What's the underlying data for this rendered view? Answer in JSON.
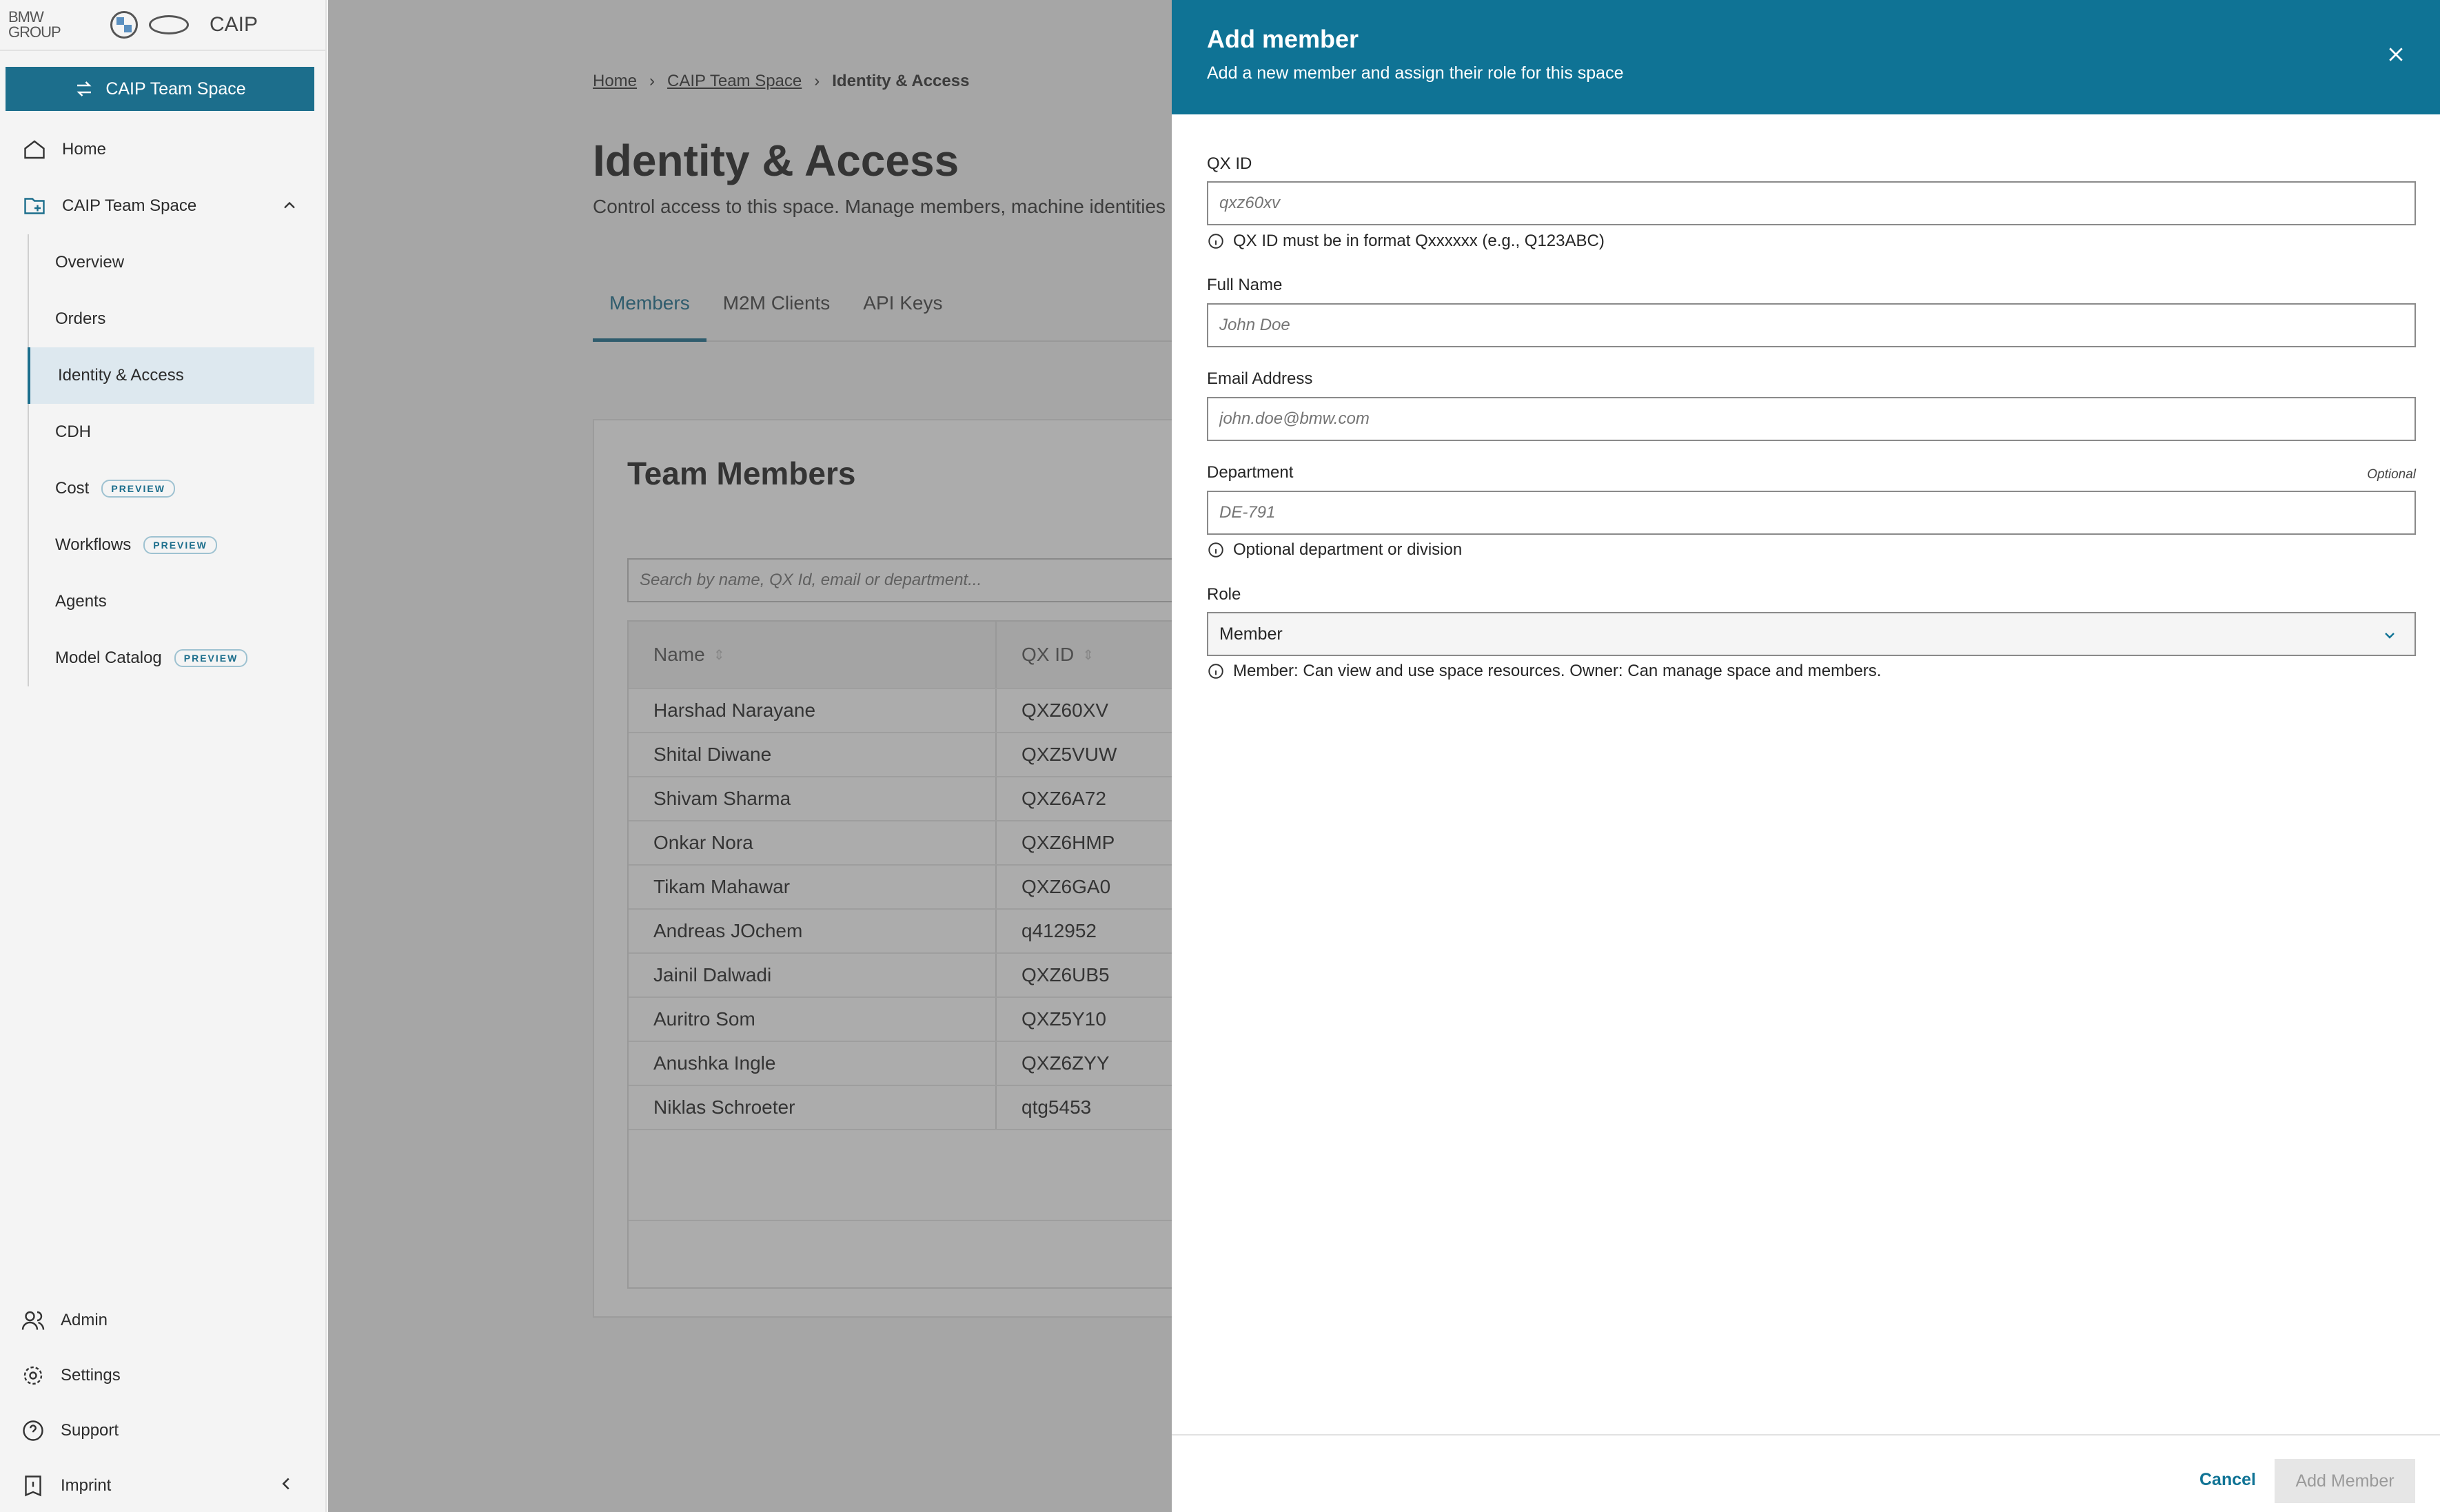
{
  "topbar": {
    "brand": "BMW GROUP",
    "app_name": "CAIP"
  },
  "sidebar": {
    "space_button": "CAIP Team Space",
    "home": "Home",
    "space": "CAIP Team Space",
    "sub_items": [
      {
        "label": "Overview"
      },
      {
        "label": "Orders"
      },
      {
        "label": "Identity & Access",
        "active": true
      },
      {
        "label": "CDH"
      },
      {
        "label": "Cost",
        "badge": "PREVIEW"
      },
      {
        "label": "Workflows",
        "badge": "PREVIEW"
      },
      {
        "label": "Agents"
      },
      {
        "label": "Model Catalog",
        "badge": "PREVIEW"
      }
    ],
    "bottom": {
      "admin": "Admin",
      "settings": "Settings",
      "support": "Support",
      "imprint": "Imprint"
    }
  },
  "breadcrumb": {
    "home": "Home",
    "space": "CAIP Team Space",
    "current": "Identity & Access"
  },
  "page": {
    "title": "Identity & Access",
    "description": "Control access to this space. Manage members, machine identities"
  },
  "tabs": [
    {
      "label": "Members",
      "active": true
    },
    {
      "label": "M2M Clients"
    },
    {
      "label": "API Keys"
    }
  ],
  "members": {
    "title": "Team Members",
    "search_placeholder": "Search by name, QX Id, email or department...",
    "columns": [
      "Name",
      "QX ID"
    ],
    "rows": [
      {
        "name": "Harshad Narayane",
        "qx": "QXZ60XV"
      },
      {
        "name": "Shital Diwane",
        "qx": "QXZ5VUW"
      },
      {
        "name": "Shivam Sharma",
        "qx": "QXZ6A72"
      },
      {
        "name": "Onkar Nora",
        "qx": "QXZ6HMP"
      },
      {
        "name": "Tikam Mahawar",
        "qx": "QXZ6GA0"
      },
      {
        "name": "Andreas JOchem",
        "qx": "q412952"
      },
      {
        "name": "Jainil Dalwadi",
        "qx": "QXZ6UB5"
      },
      {
        "name": "Auritro Som",
        "qx": "QXZ5Y10"
      },
      {
        "name": "Anushka Ingle",
        "qx": "QXZ6ZYY"
      },
      {
        "name": "Niklas Schroeter",
        "qx": "qtg5453"
      }
    ]
  },
  "drawer": {
    "title": "Add member",
    "subtitle": "Add a new member and assign their role for this space",
    "qx": {
      "label": "QX ID",
      "placeholder": "qxz60xv",
      "hint": "QX ID must be in format Qxxxxxx (e.g., Q123ABC)"
    },
    "name": {
      "label": "Full Name",
      "placeholder": "John Doe"
    },
    "email": {
      "label": "Email Address",
      "placeholder": "john.doe@bmw.com"
    },
    "department": {
      "label": "Department",
      "optional": "Optional",
      "placeholder": "DE-791",
      "hint": "Optional department or division"
    },
    "role": {
      "label": "Role",
      "value": "Member",
      "hint": "Member: Can view and use space resources. Owner: Can manage space and members."
    },
    "cancel": "Cancel",
    "submit": "Add Member"
  },
  "colors": {
    "primary": "#0f7395",
    "button": "#1c6e8c"
  }
}
